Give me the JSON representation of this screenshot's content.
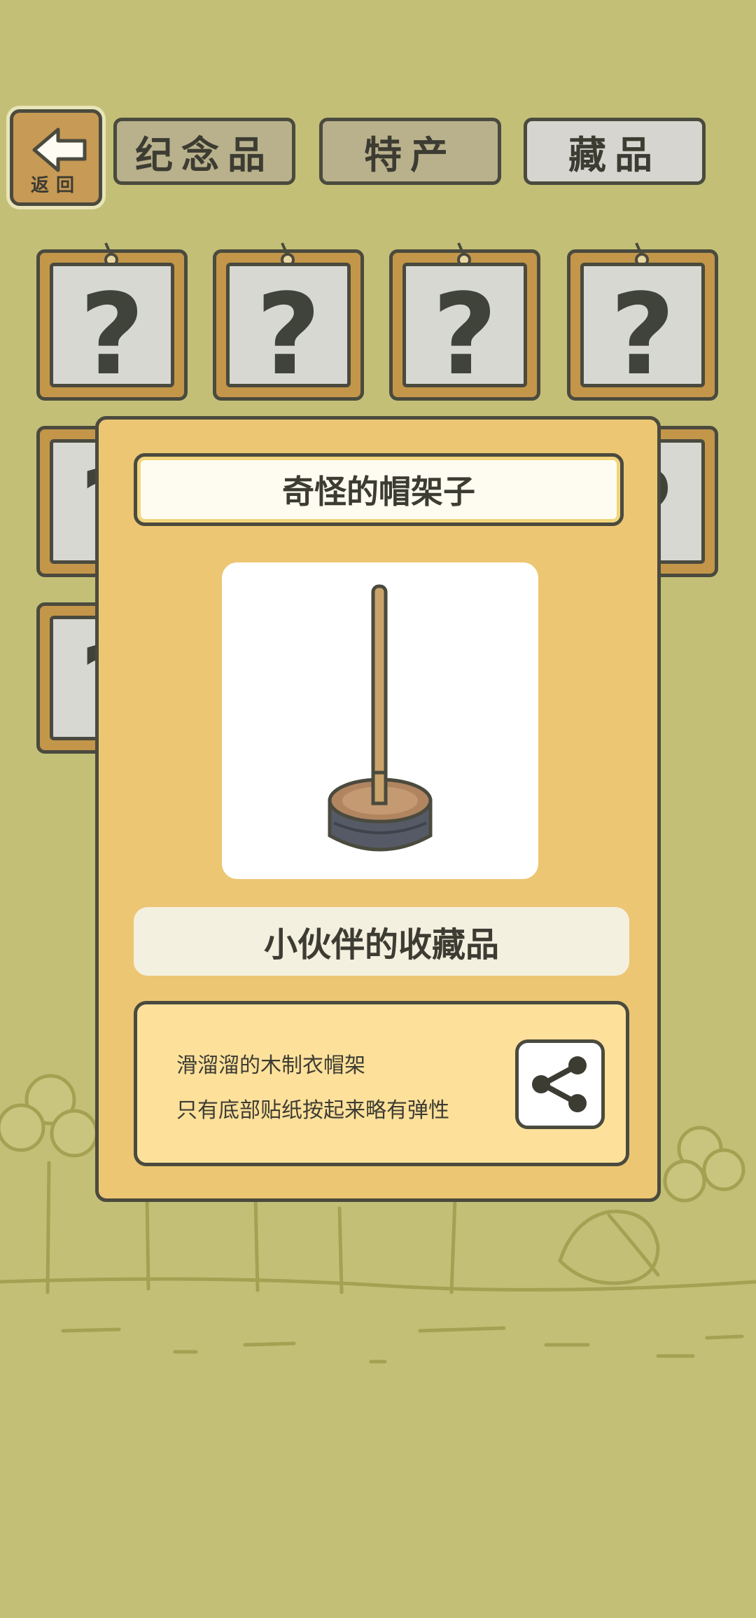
{
  "back_button": {
    "label": "返回",
    "icon": "arrow-left-icon"
  },
  "tabs": [
    {
      "label": "纪念品",
      "active": false
    },
    {
      "label": "特产",
      "active": false
    },
    {
      "label": "藏品",
      "active": true
    }
  ],
  "grid": {
    "unknown_symbol": "?"
  },
  "dialog": {
    "item_name": "奇怪的帽架子",
    "category": "小伙伴的收藏品",
    "description": [
      "滑溜溜的木制衣帽架",
      "只有底部贴纸按起来略有弹性"
    ],
    "share_icon": "share-icon",
    "item_icon": "hat-stand-icon"
  },
  "colors": {
    "background": "#c3bf77",
    "dialog": "#ecc673",
    "frame_wood": "#c39649",
    "outline": "#4a4a3e"
  }
}
